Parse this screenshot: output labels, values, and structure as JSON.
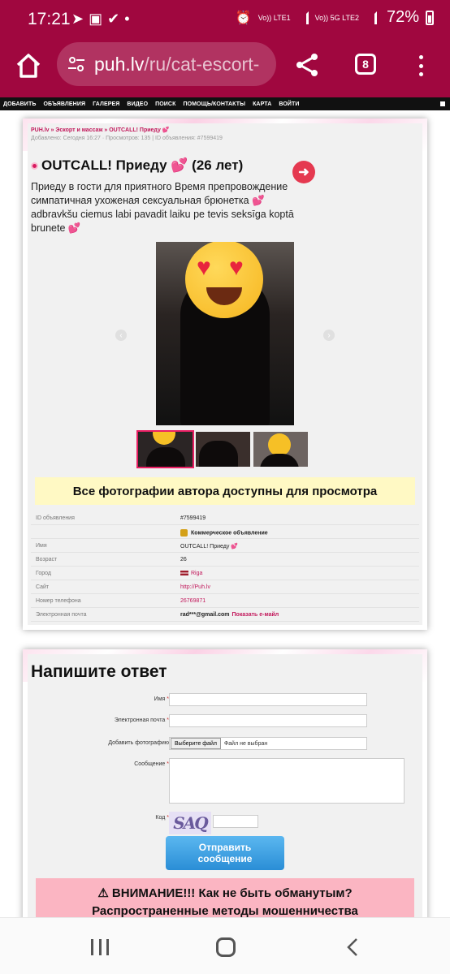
{
  "status_bar": {
    "time": "17:21",
    "icons": [
      "telegram-icon",
      "gallery-icon",
      "check-icon",
      "dot-icon"
    ],
    "sim1": "Vo)) LTE1",
    "sim2": "Vo)) 5G LTE2",
    "battery": "72%"
  },
  "browser": {
    "url_host": "puh.lv",
    "url_path": "/ru/cat-escort-",
    "tab_count": "8"
  },
  "site_nav": [
    "ДОБАВИТЬ",
    "ОБЪЯВЛЕНИЯ",
    "ГАЛЕРЕЯ",
    "ВИДЕО",
    "ПОИСК",
    "ПОМОЩЬ/КОНТАКТЫ",
    "КАРТА",
    "ВОЙТИ"
  ],
  "ad": {
    "breadcrumb": "PUH.lv » Эскорт и массаж » OUTCALL! Приеду 💕",
    "meta": "Добавлено: Сегодня 16:27 · Просмотров: 135 | ID объявления: #7599419",
    "title": "OUTCALL! Приеду 💕 (26 лет)",
    "description": "Приеду в гости для приятного Время препровождение симпатичная ухоженая сексуальная брюнетка 💕 adbravkšu ciemus labi pavadit laiku pe tevis seksīga koptā brunete 💕",
    "all_photos_banner": "Все фотографии автора доступны для просмотра",
    "details": {
      "id_label": "ID объявления",
      "id_value": "#7599419",
      "commercial": "Коммерческое объявление",
      "name_label": "Имя",
      "name_value": "OUTCALL! Приеду 💕",
      "age_label": "Возраст",
      "age_value": "26",
      "city_label": "Город",
      "city_value": "Riga",
      "site_label": "Сайт",
      "site_value": "http://Puh.lv",
      "phone_label": "Номер телефона",
      "phone_value": "26769871",
      "email_label": "Электронная почта",
      "email_value": "rad***@gmail.com",
      "email_show": "Показать e-майл"
    }
  },
  "reply": {
    "title": "Напишите ответ",
    "name_label": "Имя",
    "email_label": "Электронная почта",
    "photo_label": "Добавить фотографию",
    "file_button": "Выберите файл",
    "file_none": "Файл не выбран",
    "message_label": "Сообщение",
    "code_label": "Код",
    "captcha_text": "SAQ",
    "required_mark": "*",
    "send_button": "Отправить сообщение",
    "warning_line1": "⚠ ВНИМАНИЕ!!! Как не быть обманутым?",
    "warning_line2": "Распространенные методы мошенничества"
  },
  "colors": {
    "brand": "#a0073f",
    "accent": "#c2185b",
    "banner": "#fff9c4",
    "warning": "#fbb5c2",
    "send": "#2a8ed6"
  }
}
